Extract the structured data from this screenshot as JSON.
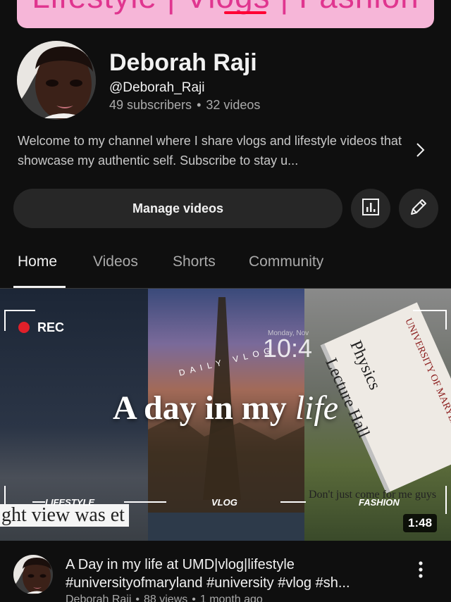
{
  "banner": {
    "text": "Lifestyle | Vlogs | Fashion"
  },
  "channel": {
    "name": "Deborah Raji",
    "handle": "@Deborah_Raji",
    "subscribers": "49 subscribers",
    "separator": "•",
    "videos": "32 videos",
    "description": "Welcome to my channel where I share vlogs and lifestyle videos that showcase my authentic self. Subscribe to stay u..."
  },
  "actions": {
    "manage_label": "Manage videos",
    "analytics_icon": "analytics-icon",
    "edit_icon": "pencil-icon"
  },
  "tabs": [
    {
      "label": "Home",
      "active": true
    },
    {
      "label": "Videos",
      "active": false
    },
    {
      "label": "Shorts",
      "active": false
    },
    {
      "label": "Community",
      "active": false
    }
  ],
  "featured_video": {
    "thumbnail": {
      "rec_label": "REC",
      "clock_time": "10:4",
      "clock_date": "Monday, Nov",
      "daily_vlog": "DAILY VLOG",
      "headline_main": "A day in my ",
      "headline_script": "life",
      "tags": [
        "LIFESTYLE",
        "VLOG",
        "FASHION"
      ],
      "caption_left": "ght view was et",
      "caption_right": "Don't just come for me guys",
      "sign_line1": "Physics",
      "sign_line2": "Lecture Hall",
      "sign_university": "UNIVERSITY OF MARYLAND",
      "duration": "1:48"
    },
    "title": "A Day in my life at UMD|vlog|lifestyle #universityofmaryland #university #vlog #sh...",
    "channel": "Deborah Raji",
    "views": "88 views",
    "age": "1 month ago"
  },
  "colors": {
    "background": "#0f0f0f",
    "surface": "#272727",
    "accent": "#ff0033",
    "banner": "#f6b6d8"
  }
}
